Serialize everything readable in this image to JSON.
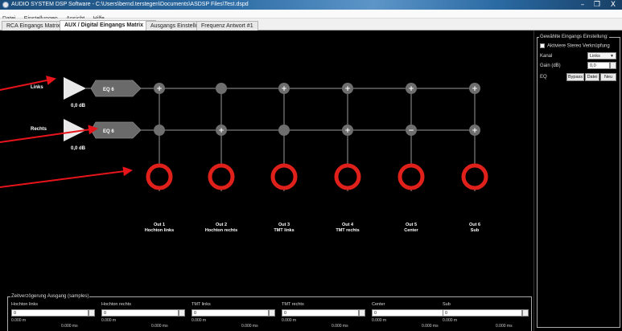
{
  "window": {
    "title": "AUDIO SYSTEM DSP Software - C:\\Users\\bernd.terstegen\\Documents\\ASDSP Files\\Test.dspd",
    "min_glyph": "–",
    "max_glyph": "❐",
    "close_glyph": "X"
  },
  "menu": [
    "Datei",
    "Einstellungen",
    "Ansicht",
    "Hilfe"
  ],
  "tabs": [
    {
      "label": "RCA Eingangs Matrix"
    },
    {
      "label": "AUX / Digital Eingangs Matrix",
      "close": "×"
    },
    {
      "label": "Ausgangs Einstellungen"
    },
    {
      "label": "Frequenz Antwort #1"
    }
  ],
  "channels": [
    {
      "name": "Links",
      "eq": "EQ 6",
      "gain": "0,0 dB"
    },
    {
      "name": "Rechts",
      "eq": "EQ 6",
      "gain": "0,0 dB"
    }
  ],
  "matrix": {
    "row_links": [
      "+",
      "",
      "+",
      "+",
      "+",
      "+"
    ],
    "row_rechts": [
      "",
      "+",
      "",
      "+",
      "−",
      "+"
    ]
  },
  "outputs": [
    {
      "line1": "Out 1",
      "line2": "Hochton links"
    },
    {
      "line1": "Out 2",
      "line2": "Hochton rechts"
    },
    {
      "line1": "Out 3",
      "line2": "TMT links"
    },
    {
      "line1": "Out 4",
      "line2": "TMT rechts"
    },
    {
      "line1": "Out 5",
      "line2": "Center"
    },
    {
      "line1": "Out 6",
      "line2": "Sub"
    }
  ],
  "panel": {
    "title": "Gewählte Eingangs Einstellung:",
    "stereo_link": "Aktiviere Stereo Verknüpfung",
    "kanal_label": "Kanal",
    "kanal_value": "Links",
    "gain_label": "Gain (dB)",
    "gain_value": "0,0",
    "eq_label": "EQ",
    "bypass": "Bypass",
    "datei": "Datei",
    "neu": "Neu"
  },
  "delay": {
    "title": "Zeitverzögerung Ausgang (samples)",
    "channels": [
      {
        "name": "Hochton links",
        "value": "0",
        "meters": "0.000 m",
        "ms": "0.000 ms"
      },
      {
        "name": "Hochton rechts",
        "value": "0",
        "meters": "0.000 m",
        "ms": "0.000 ms"
      },
      {
        "name": "TMT links",
        "value": "0",
        "meters": "0.000 m",
        "ms": "0.000 ms"
      },
      {
        "name": "TMT rechts",
        "value": "0",
        "meters": "0.000 m",
        "ms": "0.000 ms"
      },
      {
        "name": "Center",
        "value": "0",
        "meters": "0.000 m",
        "ms": "0.000 ms"
      },
      {
        "name": "Sub",
        "value": "0",
        "meters": "0.000 m",
        "ms": "0.000 ms"
      }
    ]
  },
  "colors": {
    "node": "#6e6e6e",
    "output_ring": "#e0201a",
    "annotation": "#e8141b",
    "eq_block": "#6a6a6a"
  },
  "icons": {
    "app": "app-icon",
    "checkbox": "checkbox-unchecked",
    "dropdown": "chevron-down-icon",
    "spinner": "spin-arrows-icon"
  }
}
